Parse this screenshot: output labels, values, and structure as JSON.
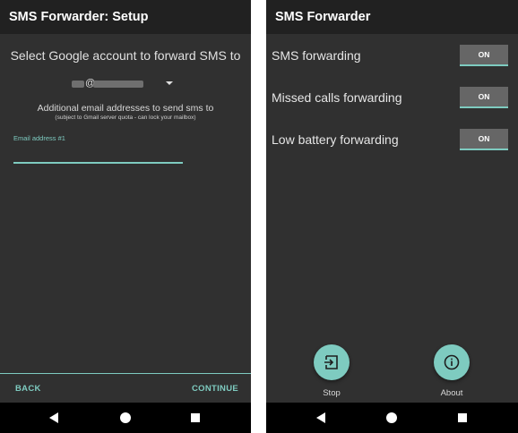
{
  "setup_screen": {
    "title": "SMS Forwarder: Setup",
    "heading": "Select Google account to forward SMS to",
    "account_at": "@",
    "additional_label": "Additional email addresses to send sms to",
    "additional_note": "(subject to Gmail server quota - can lock your mailbox)",
    "email_field_label": "Email address #1",
    "email_field_value": "",
    "back_label": "BACK",
    "continue_label": "CONTINUE"
  },
  "main_screen": {
    "title": "SMS Forwarder",
    "settings": [
      {
        "label": "SMS forwarding",
        "state": "ON"
      },
      {
        "label": "Missed calls forwarding",
        "state": "ON"
      },
      {
        "label": "Low battery forwarding",
        "state": "ON"
      }
    ],
    "stop_label": "Stop",
    "about_label": "About"
  },
  "icons": {
    "dropdown": "chevron-down-icon",
    "stop": "exit-icon",
    "about": "info-icon",
    "nav_back": "back-triangle-icon",
    "nav_home": "home-circle-icon",
    "nav_recent": "recents-square-icon"
  },
  "colors": {
    "accent": "#7ecbc0",
    "background": "#303030",
    "appbar": "#212121",
    "toggle_bg": "#666666",
    "navbar": "#000000"
  }
}
